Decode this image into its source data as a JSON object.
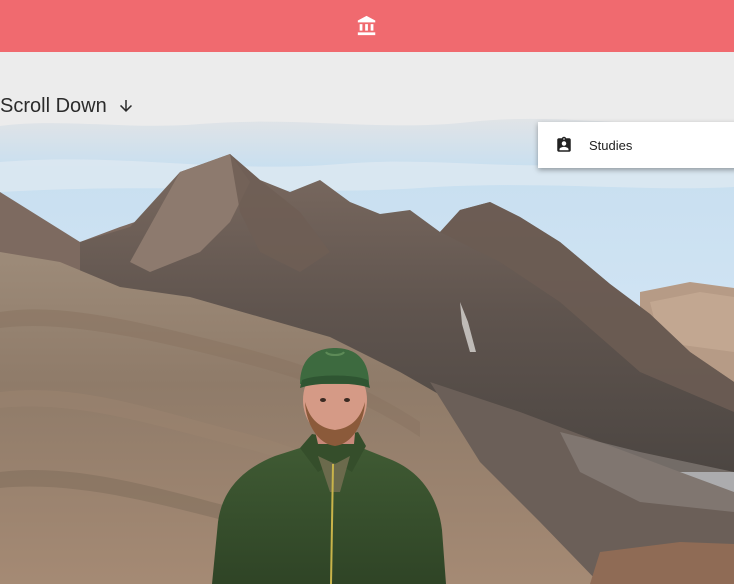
{
  "appbar": {
    "icon": "bank-icon",
    "color": "#f06a6f"
  },
  "hero": {
    "scroll_label": "Scroll Down",
    "scroll_icon": "arrow-down-icon"
  },
  "side_card": {
    "icon": "assignment-ind-icon",
    "label": "Studies"
  }
}
